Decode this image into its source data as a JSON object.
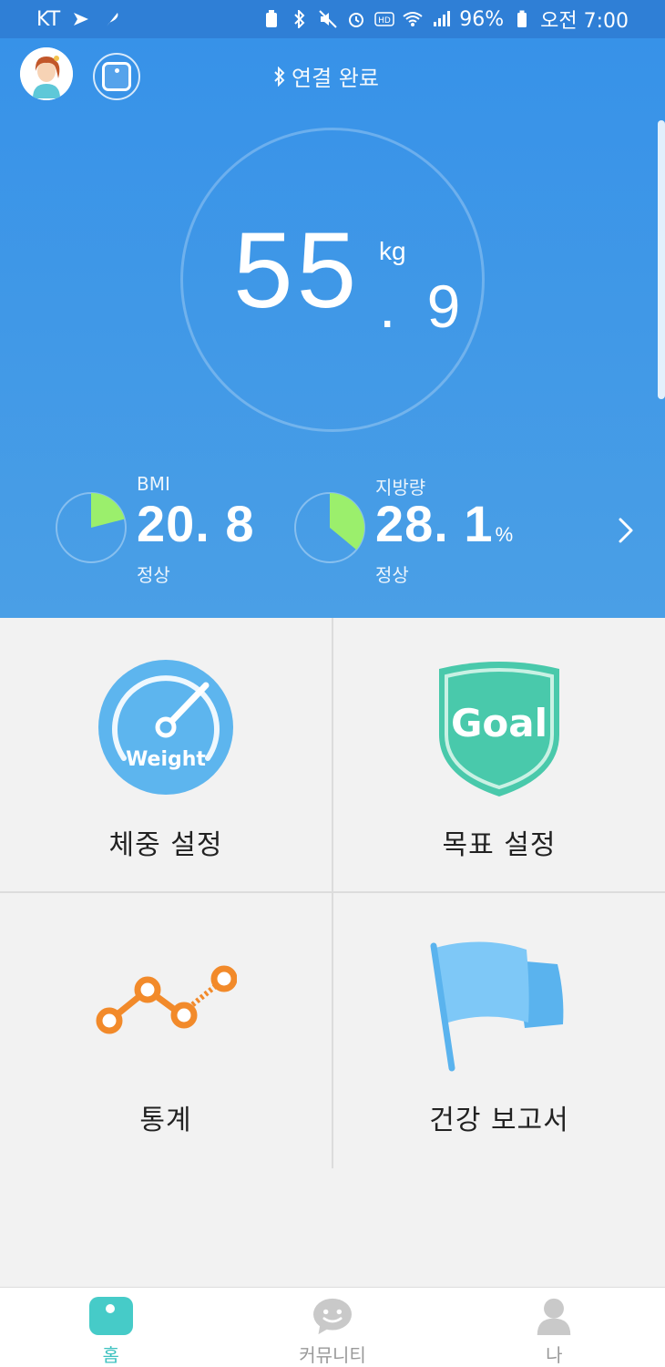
{
  "status_bar": {
    "carrier": "KT",
    "battery": "96%",
    "time": "오전 7:00"
  },
  "header": {
    "bluetooth_status": "연결 완료",
    "weight": {
      "integer": "55",
      "unit": "kg",
      "decimal": ". 9"
    },
    "metrics": {
      "bmi": {
        "label": "BMI",
        "value": "20. 8",
        "unit": "",
        "status": "정상",
        "fill_fraction": 0.21
      },
      "fat": {
        "label": "지방량",
        "value": "28. 1",
        "unit": "%",
        "status": "정상",
        "fill_fraction": 0.36
      }
    },
    "colors": {
      "accent_green": "#9bef6c",
      "header_blue": "#3792e8"
    }
  },
  "grid": {
    "weight_setting": {
      "label": "체중 설정",
      "icon_text": "Weight"
    },
    "goal_setting": {
      "label": "목표 설정",
      "icon_text": "Goal"
    },
    "statistics": {
      "label": "통계"
    },
    "health_report": {
      "label": "건강 보고서"
    }
  },
  "bottom_nav": {
    "items": [
      {
        "label": "홈",
        "active": true
      },
      {
        "label": "커뮤니티",
        "active": false
      },
      {
        "label": "나",
        "active": false
      }
    ]
  }
}
